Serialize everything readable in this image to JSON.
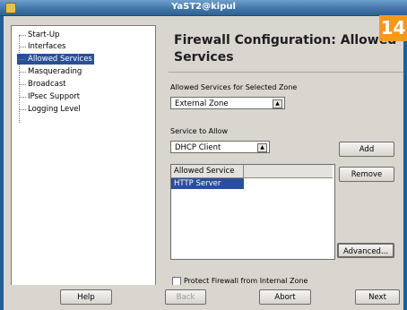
{
  "window": {
    "title": "YaST2@kipul"
  },
  "page_badge": "14",
  "sidebar": {
    "items": [
      {
        "label": "Start-Up"
      },
      {
        "label": "Interfaces"
      },
      {
        "label": "Allowed Services",
        "selected": true
      },
      {
        "label": "Masquerading"
      },
      {
        "label": "Broadcast"
      },
      {
        "label": "IPsec Support"
      },
      {
        "label": "Logging Level"
      }
    ]
  },
  "main": {
    "heading": "Firewall Configuration: Allowed Services",
    "zone_label": "Allowed Services for Selected Zone",
    "zone_value": "External Zone",
    "service_label": "Service to Allow",
    "service_value": "DHCP Client",
    "add_label": "Add",
    "remove_label": "Remove",
    "table_header": "Allowed Service",
    "table_rows": [
      "HTTP Server"
    ],
    "protect_label": "Protect Firewall from Internal Zone",
    "advanced_label": "Advanced..."
  },
  "footer": {
    "help_label": "Help",
    "back_label": "Back",
    "abort_label": "Abort",
    "next_label": "Next"
  }
}
